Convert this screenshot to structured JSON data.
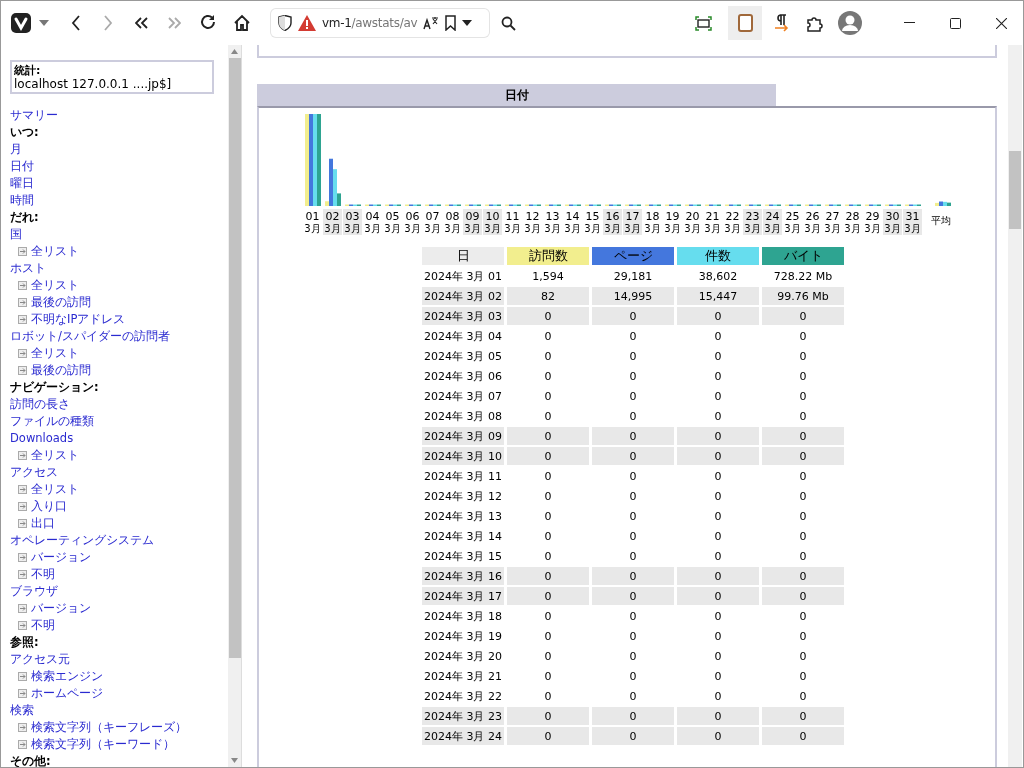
{
  "browser": {
    "url_host": "vm-1",
    "url_path": "/awstats/av"
  },
  "sidebar": {
    "stats_label": "統計:",
    "stats_value": "localhost 127.0.0.1 ....jp$]",
    "items": [
      {
        "kind": "link",
        "text": "サマリー"
      },
      {
        "kind": "heading",
        "text": "いつ:"
      },
      {
        "kind": "link",
        "text": "月"
      },
      {
        "kind": "link",
        "text": "日付"
      },
      {
        "kind": "link",
        "text": "曜日"
      },
      {
        "kind": "link",
        "text": "時間"
      },
      {
        "kind": "heading",
        "text": "だれ:"
      },
      {
        "kind": "link",
        "text": "国",
        "children": [
          {
            "text": "全リスト"
          }
        ]
      },
      {
        "kind": "link",
        "text": "ホスト",
        "children": [
          {
            "text": "全リスト"
          },
          {
            "text": "最後の訪問"
          },
          {
            "text": "不明なIPアドレス"
          }
        ]
      },
      {
        "kind": "link",
        "text": "ロボット/スパイダーの訪問者",
        "children": [
          {
            "text": "全リスト"
          },
          {
            "text": "最後の訪問"
          }
        ]
      },
      {
        "kind": "heading",
        "text": "ナビゲーション:"
      },
      {
        "kind": "link",
        "text": "訪問の長さ"
      },
      {
        "kind": "link",
        "text": "ファイルの種類"
      },
      {
        "kind": "link",
        "text": "Downloads",
        "children": [
          {
            "text": "全リスト"
          }
        ]
      },
      {
        "kind": "link",
        "text": "アクセス",
        "children": [
          {
            "text": "全リスト"
          },
          {
            "text": "入り口"
          },
          {
            "text": "出口"
          }
        ]
      },
      {
        "kind": "link",
        "text": "オペレーティングシステム",
        "children": [
          {
            "text": "バージョン"
          },
          {
            "text": "不明"
          }
        ]
      },
      {
        "kind": "link",
        "text": "ブラウザ",
        "children": [
          {
            "text": "バージョン"
          },
          {
            "text": "不明"
          }
        ]
      },
      {
        "kind": "heading",
        "text": "参照:"
      },
      {
        "kind": "link",
        "text": "アクセス元",
        "children": [
          {
            "text": "検索エンジン"
          },
          {
            "text": "ホームページ"
          }
        ]
      },
      {
        "kind": "link",
        "text": "検索",
        "children": [
          {
            "text": "検索文字列（キーフレーズ）"
          },
          {
            "text": "検索文字列（キーワード）"
          }
        ]
      },
      {
        "kind": "heading",
        "text": "その他:"
      }
    ]
  },
  "section": {
    "title": "日付",
    "chart": {
      "average_label": "平均",
      "days": [
        {
          "day": "01",
          "month": "3月",
          "weekend": false
        },
        {
          "day": "02",
          "month": "3月",
          "weekend": true
        },
        {
          "day": "03",
          "month": "3月",
          "weekend": true
        },
        {
          "day": "04",
          "month": "3月",
          "weekend": false
        },
        {
          "day": "05",
          "month": "3月",
          "weekend": false
        },
        {
          "day": "06",
          "month": "3月",
          "weekend": false
        },
        {
          "day": "07",
          "month": "3月",
          "weekend": false
        },
        {
          "day": "08",
          "month": "3月",
          "weekend": false
        },
        {
          "day": "09",
          "month": "3月",
          "weekend": true
        },
        {
          "day": "10",
          "month": "3月",
          "weekend": true
        },
        {
          "day": "11",
          "month": "3月",
          "weekend": false
        },
        {
          "day": "12",
          "month": "3月",
          "weekend": false
        },
        {
          "day": "13",
          "month": "3月",
          "weekend": false
        },
        {
          "day": "14",
          "month": "3月",
          "weekend": false
        },
        {
          "day": "15",
          "month": "3月",
          "weekend": false
        },
        {
          "day": "16",
          "month": "3月",
          "weekend": true
        },
        {
          "day": "17",
          "month": "3月",
          "weekend": true
        },
        {
          "day": "18",
          "month": "3月",
          "weekend": false
        },
        {
          "day": "19",
          "month": "3月",
          "weekend": false
        },
        {
          "day": "20",
          "month": "3月",
          "weekend": false
        },
        {
          "day": "21",
          "month": "3月",
          "weekend": false
        },
        {
          "day": "22",
          "month": "3月",
          "weekend": false
        },
        {
          "day": "23",
          "month": "3月",
          "weekend": true
        },
        {
          "day": "24",
          "month": "3月",
          "weekend": true
        },
        {
          "day": "25",
          "month": "3月",
          "weekend": false
        },
        {
          "day": "26",
          "month": "3月",
          "weekend": false
        },
        {
          "day": "27",
          "month": "3月",
          "weekend": false
        },
        {
          "day": "28",
          "month": "3月",
          "weekend": false
        },
        {
          "day": "29",
          "month": "3月",
          "weekend": false
        },
        {
          "day": "30",
          "month": "3月",
          "weekend": true
        },
        {
          "day": "31",
          "month": "3月",
          "weekend": true
        }
      ]
    },
    "table": {
      "columns": [
        {
          "label": "日"
        },
        {
          "label": "訪問数",
          "color": "#f2ee8e"
        },
        {
          "label": "ページ",
          "color": "#4477dd"
        },
        {
          "label": "件数",
          "color": "#66ddee"
        },
        {
          "label": "バイト",
          "color": "#2ea491"
        }
      ],
      "rows": [
        {
          "date": "2024年 3月 01",
          "values": [
            "1,594",
            "29,181",
            "38,602",
            "728.22 Mb"
          ],
          "weekend": false
        },
        {
          "date": "2024年 3月 02",
          "values": [
            "82",
            "14,995",
            "15,447",
            "99.76 Mb"
          ],
          "weekend": true
        },
        {
          "date": "2024年 3月 03",
          "values": [
            "0",
            "0",
            "0",
            "0"
          ],
          "weekend": true
        },
        {
          "date": "2024年 3月 04",
          "values": [
            "0",
            "0",
            "0",
            "0"
          ],
          "weekend": false
        },
        {
          "date": "2024年 3月 05",
          "values": [
            "0",
            "0",
            "0",
            "0"
          ],
          "weekend": false
        },
        {
          "date": "2024年 3月 06",
          "values": [
            "0",
            "0",
            "0",
            "0"
          ],
          "weekend": false
        },
        {
          "date": "2024年 3月 07",
          "values": [
            "0",
            "0",
            "0",
            "0"
          ],
          "weekend": false
        },
        {
          "date": "2024年 3月 08",
          "values": [
            "0",
            "0",
            "0",
            "0"
          ],
          "weekend": false
        },
        {
          "date": "2024年 3月 09",
          "values": [
            "0",
            "0",
            "0",
            "0"
          ],
          "weekend": true
        },
        {
          "date": "2024年 3月 10",
          "values": [
            "0",
            "0",
            "0",
            "0"
          ],
          "weekend": true
        },
        {
          "date": "2024年 3月 11",
          "values": [
            "0",
            "0",
            "0",
            "0"
          ],
          "weekend": false
        },
        {
          "date": "2024年 3月 12",
          "values": [
            "0",
            "0",
            "0",
            "0"
          ],
          "weekend": false
        },
        {
          "date": "2024年 3月 13",
          "values": [
            "0",
            "0",
            "0",
            "0"
          ],
          "weekend": false
        },
        {
          "date": "2024年 3月 14",
          "values": [
            "0",
            "0",
            "0",
            "0"
          ],
          "weekend": false
        },
        {
          "date": "2024年 3月 15",
          "values": [
            "0",
            "0",
            "0",
            "0"
          ],
          "weekend": false
        },
        {
          "date": "2024年 3月 16",
          "values": [
            "0",
            "0",
            "0",
            "0"
          ],
          "weekend": true
        },
        {
          "date": "2024年 3月 17",
          "values": [
            "0",
            "0",
            "0",
            "0"
          ],
          "weekend": true
        },
        {
          "date": "2024年 3月 18",
          "values": [
            "0",
            "0",
            "0",
            "0"
          ],
          "weekend": false
        },
        {
          "date": "2024年 3月 19",
          "values": [
            "0",
            "0",
            "0",
            "0"
          ],
          "weekend": false
        },
        {
          "date": "2024年 3月 20",
          "values": [
            "0",
            "0",
            "0",
            "0"
          ],
          "weekend": false
        },
        {
          "date": "2024年 3月 21",
          "values": [
            "0",
            "0",
            "0",
            "0"
          ],
          "weekend": false
        },
        {
          "date": "2024年 3月 22",
          "values": [
            "0",
            "0",
            "0",
            "0"
          ],
          "weekend": false
        },
        {
          "date": "2024年 3月 23",
          "values": [
            "0",
            "0",
            "0",
            "0"
          ],
          "weekend": true
        },
        {
          "date": "2024年 3月 24",
          "values": [
            "0",
            "0",
            "0",
            "0"
          ],
          "weekend": true
        }
      ]
    }
  }
}
